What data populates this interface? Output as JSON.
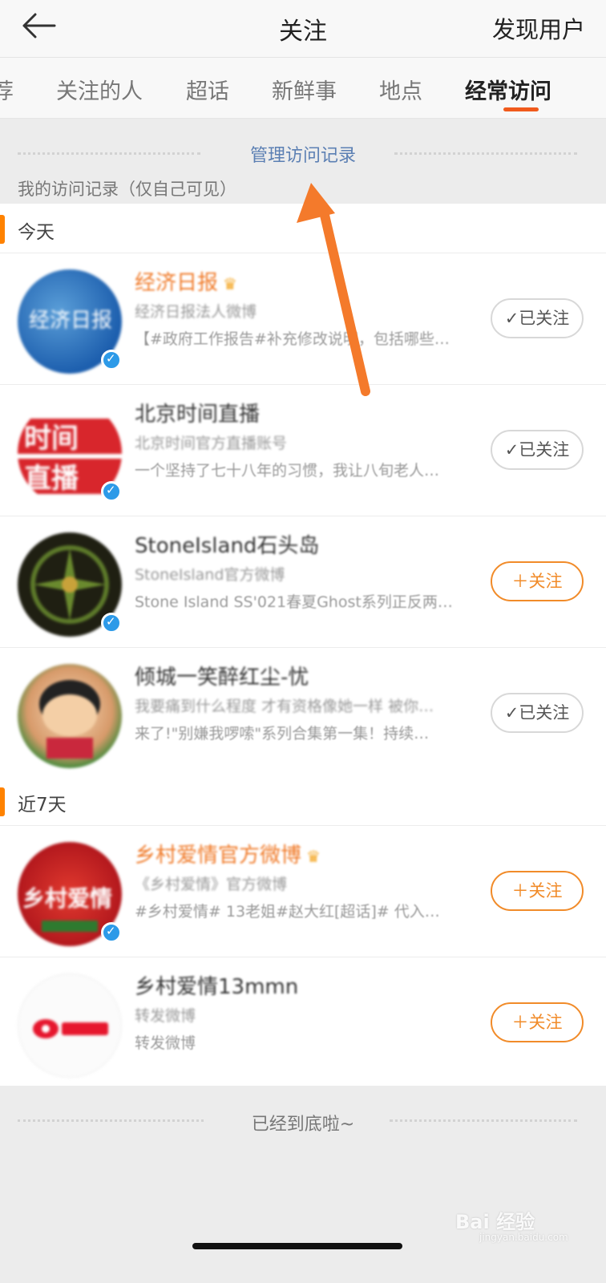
{
  "header": {
    "title": "关注",
    "right_action": "发现用户"
  },
  "tabs": [
    {
      "label": "荐"
    },
    {
      "label": "关注的人"
    },
    {
      "label": "超话"
    },
    {
      "label": "新鲜事"
    },
    {
      "label": "地点"
    },
    {
      "label": "经常访问"
    }
  ],
  "active_tab": "经常访问",
  "manage": {
    "link": "管理访问记录",
    "note": "我的访问记录（仅自己可见）"
  },
  "sections": [
    {
      "title": "今天",
      "items": [
        {
          "name": "经济日报",
          "vip": true,
          "sub1": "经济日报法人微博",
          "sub2": "【#政府工作报告#补充修改说明，包括哪些…",
          "button": "已关注",
          "followed": true
        },
        {
          "name": "北京时间直播",
          "vip": false,
          "sub1": "北京时间官方直播账号",
          "sub2": "一个坚持了七十八年的习惯，我让八旬老人…",
          "button": "已关注",
          "followed": true
        },
        {
          "name": "StoneIsland石头岛",
          "vip": false,
          "sub1": "StoneIsland官方微博",
          "sub2": "Stone Island SS'021春夏Ghost系列正反两…",
          "button": "关注",
          "followed": false
        },
        {
          "name": "倾城一笑醉红尘-忧",
          "vip": false,
          "sub1": "我要痛到什么程度 才有资格像她一样 被你…",
          "sub2": "来了!\"别嫌我啰嗦\"系列合集第一集！持续…",
          "button": "已关注",
          "followed": true
        }
      ]
    },
    {
      "title": "近7天",
      "items": [
        {
          "name": "乡村爱情官方微博",
          "vip": true,
          "sub1": "《乡村爱情》官方微博",
          "sub2": "#乡村爱情# 13老姐#赵大红[超话]# 代入…",
          "button": "关注",
          "followed": false
        },
        {
          "name": "乡村爱情13mmn",
          "vip": false,
          "sub1": "转发微博",
          "sub2": "转发微博",
          "button": "关注",
          "followed": false
        }
      ]
    }
  ],
  "footer": {
    "end_text": "已经到底啦~",
    "watermark": "Bai 经验",
    "watermark_sub": "jingyan.baidu.com"
  },
  "colors": {
    "accent": "#f05a1c",
    "follow": "#f18b29",
    "link": "#5b7fb3",
    "annotation_arrow": "#f47a2b"
  }
}
